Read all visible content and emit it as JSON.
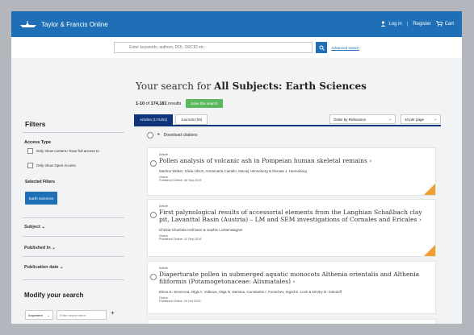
{
  "header": {
    "brand": "Taylor & Francis Online",
    "login": "Log in",
    "register": "Register",
    "cart": "Cart"
  },
  "search": {
    "placeholder": "Enter keywords, authors, DOI, ORCID etc",
    "advanced": "Advanced search"
  },
  "results": {
    "prefix": "Your search for ",
    "query": "All Subjects: Earth Sciences",
    "range": "1-10",
    "of": " of ",
    "total": "174,181",
    "suffix": " results",
    "save_label": "Save this search",
    "tabs": [
      "Articles (174181)",
      "Journals (59)"
    ],
    "sort": "Order by Relevance",
    "per_page": "10 per page",
    "download": "Download citations"
  },
  "sidebar": {
    "title": "Filters",
    "access_type": "Access Type",
    "options": [
      "Only show content I have full access to",
      "Only show Open Access"
    ],
    "selected_filters": "Selected Filters",
    "chip": "Earth Sciences",
    "accordions": [
      "Subject",
      "Published In",
      "Publication date"
    ],
    "modify_title": "Modify your search",
    "anywhere": "Anywhere",
    "term_placeholder": "Enter search term",
    "plus": "+"
  },
  "articles": [
    {
      "type": "Article",
      "title": "Pollen analysis of volcanic ash in Pompeian human skeletal remains",
      "authors": "Martina Weber, Silvia Ulrich, Annamaria Ciarallo, Maciej Henneberg & Renata J. Henneberg",
      "journal": "Grana",
      "date": "Published Online: 06 Sep 2019"
    },
    {
      "type": "Article",
      "title": "First palynological results of accessorial elements from the Langhian Schaßbach clay pit, Lavanttal Basin (Austria) – LM and SEM investigations of Cornales and Ericales",
      "authors": "Christa-Charlotte Hofmann & Sophie Lichtenwagner",
      "journal": "Grana",
      "date": "Published Online: 12 Sep 2019"
    },
    {
      "type": "Article",
      "title": "Diaperturate pollen in submerged aquatic monocots Althenia orientalis and Althenia filiformis (Potamogetonaceae: Alismatales)",
      "authors": "Elena E. Severova, Olga A. Volkova, Olga N. Demina, Constantin I. Fomichev, Ingrid E. Lock & Dmitry D. Sokoloff",
      "journal": "Grana",
      "date": "Published Online: 24 Oct 2019"
    }
  ]
}
